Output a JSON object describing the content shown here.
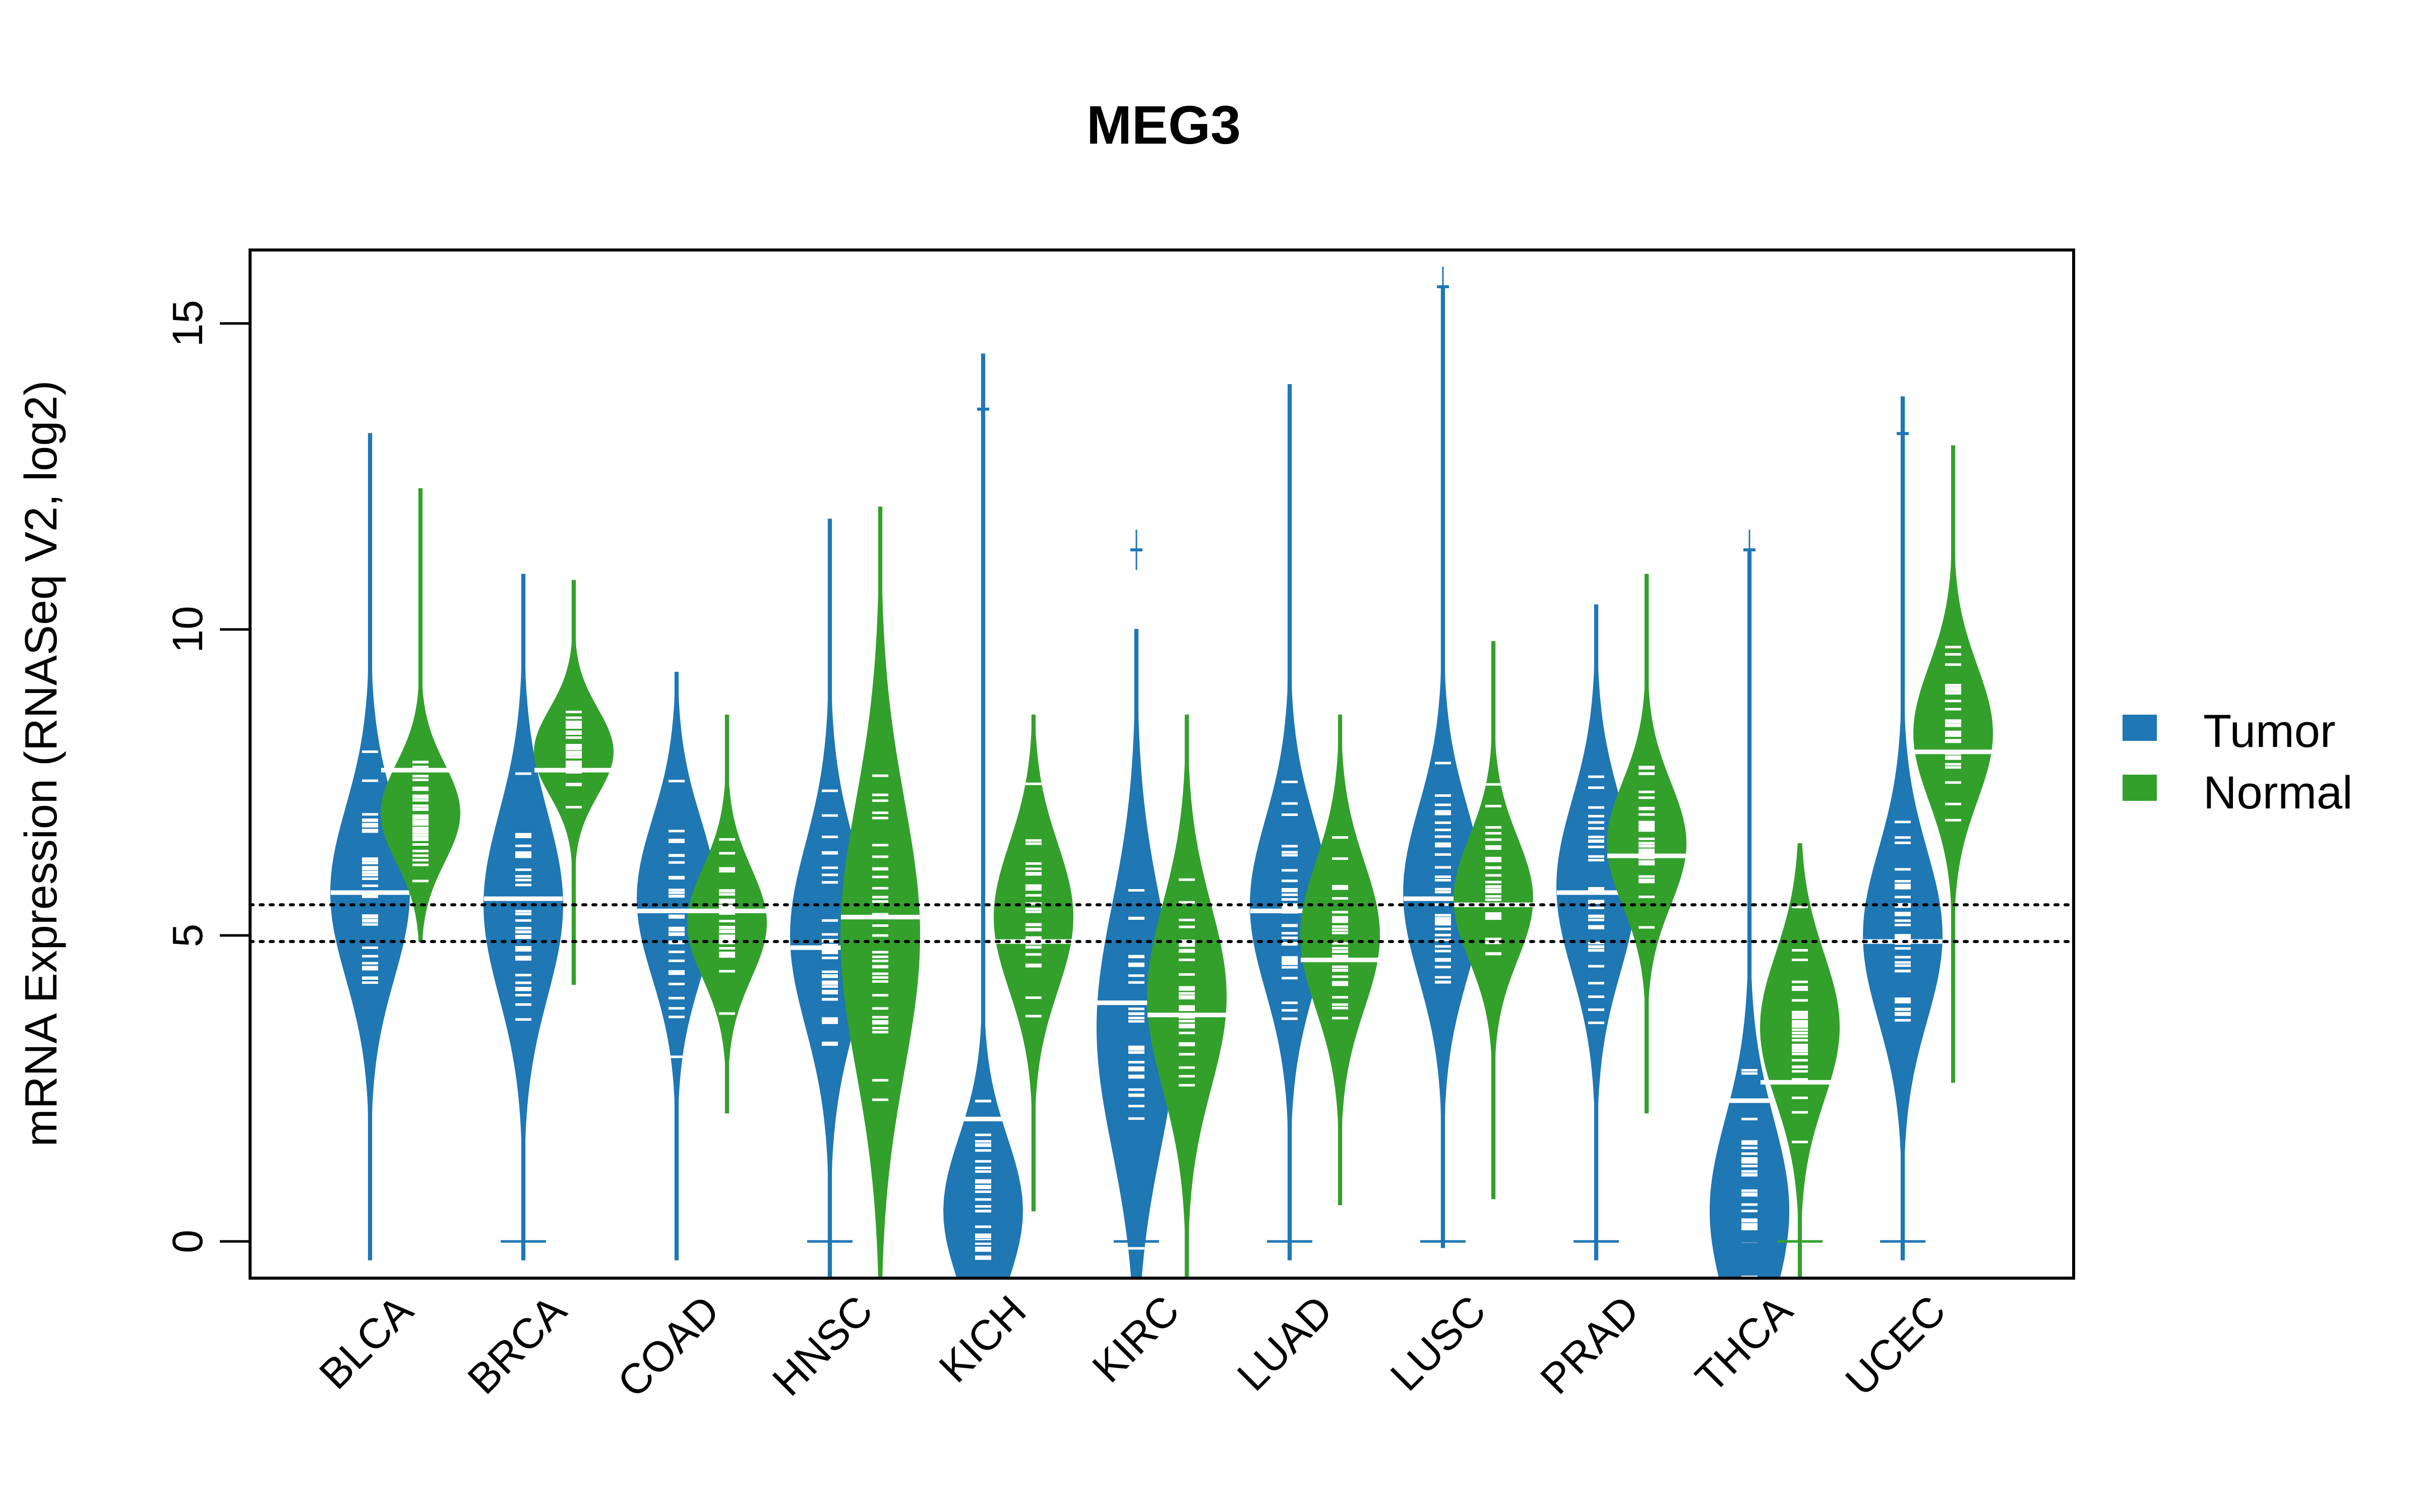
{
  "chart_data": {
    "type": "beanplot",
    "title": "MEG3",
    "xlabel": "",
    "ylabel": "mRNA Expression (RNASeq V2, log2)",
    "ylim": [
      -0.6,
      16.2
    ],
    "yticks": [
      0,
      5,
      10,
      15
    ],
    "grid": false,
    "legend_position": "right",
    "reference_lines": [
      5.5,
      4.9
    ],
    "categories": [
      "BLCA",
      "BRCA",
      "COAD",
      "HNSC",
      "KICH",
      "KIRC",
      "LUAD",
      "LUSC",
      "PRAD",
      "THCA",
      "UCEC"
    ],
    "series": [
      {
        "name": "Tumor",
        "color": "#1F77B4",
        "medians": [
          5.7,
          5.6,
          5.4,
          4.8,
          2.0,
          3.9,
          5.4,
          5.6,
          5.7,
          2.3,
          4.9
        ],
        "min": [
          -0.3,
          -0.3,
          -0.3,
          -0.6,
          -0.6,
          -0.6,
          -0.3,
          -0.1,
          -0.3,
          -0.6,
          -0.3
        ],
        "max": [
          13.2,
          10.9,
          9.3,
          11.8,
          14.5,
          10.0,
          14.0,
          15.6,
          10.4,
          11.3,
          13.8
        ],
        "density_peak": [
          5.7,
          5.5,
          5.6,
          5.0,
          0.5,
          3.5,
          5.5,
          5.7,
          5.8,
          0.5,
          5.0
        ],
        "spread": [
          1.4,
          1.5,
          1.3,
          1.5,
          1.2,
          2.0,
          1.4,
          1.4,
          1.4,
          1.5,
          1.4
        ],
        "zeros_marker": [
          false,
          true,
          false,
          true,
          true,
          true,
          true,
          true,
          true,
          true,
          true
        ]
      },
      {
        "name": "Normal",
        "color": "#33A02C",
        "medians": [
          7.7,
          7.7,
          5.4,
          5.3,
          4.9,
          3.7,
          4.6,
          5.5,
          6.3,
          2.6,
          8.0
        ],
        "min": [
          4.9,
          4.2,
          2.1,
          -0.6,
          0.5,
          -0.6,
          0.6,
          0.7,
          2.1,
          -0.6,
          2.6
        ],
        "max": [
          12.3,
          10.8,
          8.6,
          12.0,
          8.6,
          8.6,
          8.6,
          9.8,
          10.9,
          6.5,
          13.0
        ],
        "density_peak": [
          7.0,
          8.0,
          5.2,
          5.0,
          5.3,
          4.0,
          5.0,
          5.6,
          6.5,
          3.5,
          8.3
        ],
        "spread": [
          0.8,
          0.7,
          0.9,
          2.2,
          1.2,
          1.5,
          1.2,
          1.0,
          1.0,
          1.2,
          1.1
        ],
        "zeros_marker": [
          false,
          false,
          false,
          false,
          false,
          false,
          false,
          false,
          false,
          true,
          false
        ]
      }
    ],
    "outliers": {
      "KICH_Tumor_high": 13.6,
      "KIRC_Tumor_high": 11.3,
      "LUSC_Tumor_high": 15.6,
      "THCA_Tumor_high": 11.3,
      "UCEC_Tumor_high": 13.2
    }
  },
  "legend": {
    "items": [
      {
        "label": "Tumor",
        "color": "#1F77B4"
      },
      {
        "label": "Normal",
        "color": "#33A02C"
      }
    ]
  }
}
